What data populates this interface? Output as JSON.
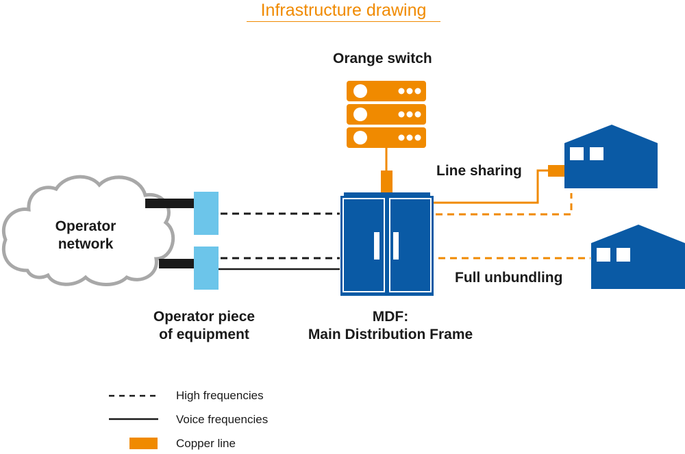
{
  "title": "Infrastructure drawing",
  "colors": {
    "orange": "#f08a00",
    "blue": "#0a5aa5",
    "light_blue": "#6cc5ea",
    "cloud_stroke": "#a8a8a8",
    "text": "#1a1a1a"
  },
  "nodes": {
    "operator_network": {
      "line1": "Operator",
      "line2": "network"
    },
    "operator_equipment": {
      "line1": "Operator piece",
      "line2": "of equipment"
    },
    "orange_switch": {
      "label": "Orange switch"
    },
    "mdf": {
      "line1": "MDF:",
      "line2": "Main Distribution Frame"
    },
    "line_sharing": {
      "label": "Line sharing"
    },
    "full_unbundling": {
      "label": "Full unbundling"
    }
  },
  "legend": [
    {
      "style": "dashed",
      "label": "High frequencies"
    },
    {
      "style": "solid",
      "label": "Voice frequencies"
    },
    {
      "style": "orange-block",
      "label": "Copper line"
    }
  ]
}
